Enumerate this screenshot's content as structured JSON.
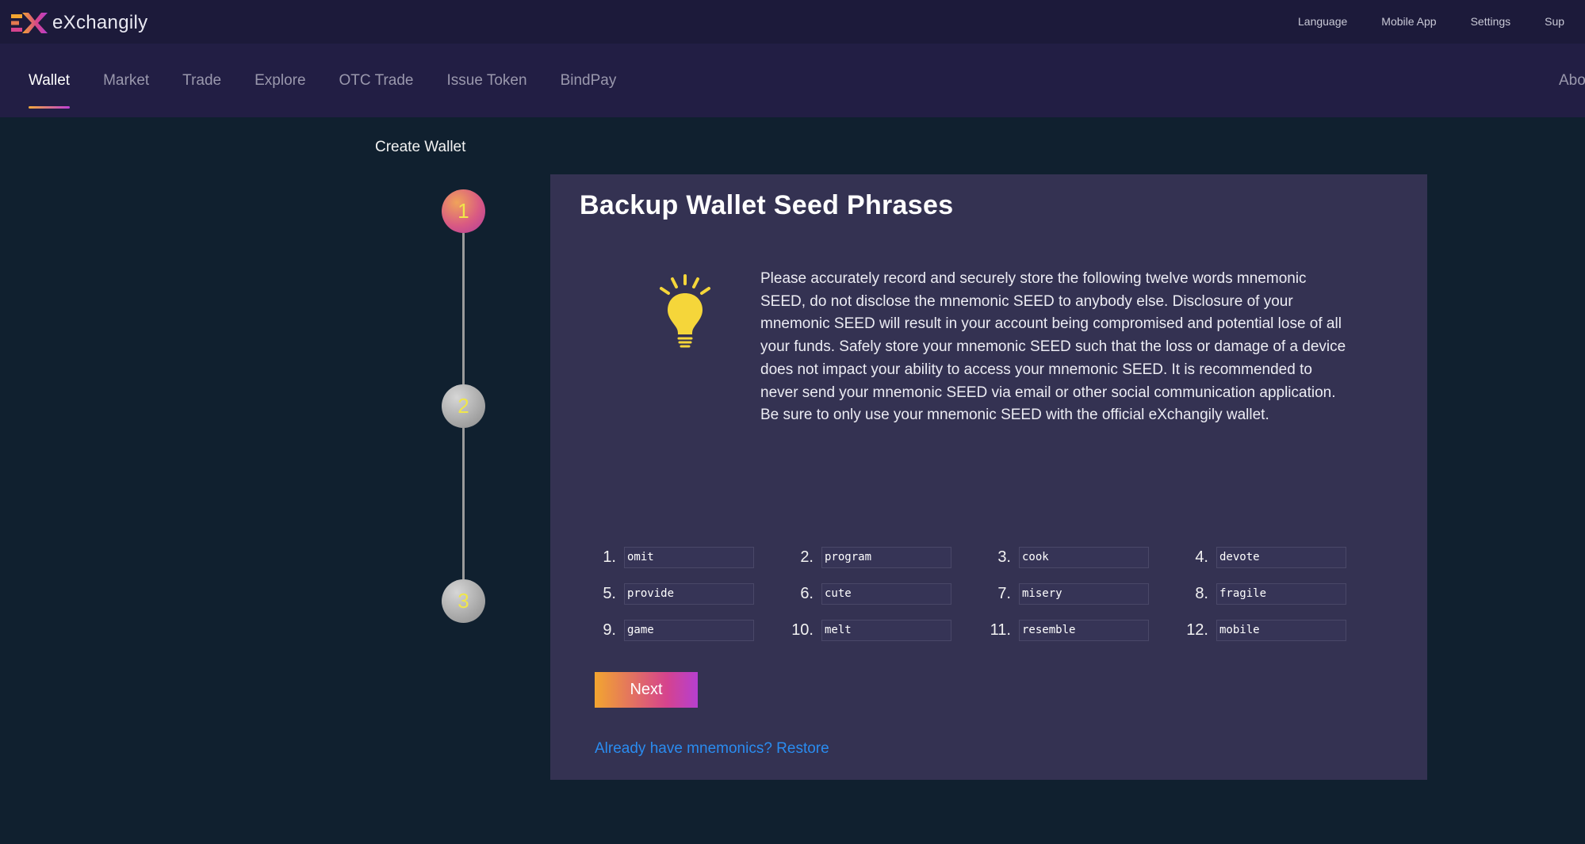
{
  "brand": {
    "name": "eXchangily"
  },
  "top_links": [
    "Language",
    "Mobile App",
    "Settings",
    "Sup"
  ],
  "nav": {
    "tabs": [
      "Wallet",
      "Market",
      "Trade",
      "Explore",
      "OTC Trade",
      "Issue Token",
      "BindPay"
    ],
    "active_index": 0,
    "right_label": "Abo"
  },
  "page_title": "Create Wallet",
  "steps": [
    {
      "label": "1",
      "state": "active"
    },
    {
      "label": "2",
      "state": "inactive"
    },
    {
      "label": "3",
      "state": "inactive"
    }
  ],
  "card": {
    "title": "Backup Wallet Seed Phrases",
    "description": "Please accurately record and securely store the following twelve words mnemonic SEED, do not disclose the mnemonic SEED to anybody else. Disclosure of your mnemonic SEED will result in your account being compromised and potential lose of all your funds. Safely store your mnemonic SEED such that the loss or damage of a device does not impact your ability to access your mnemonic SEED. It is recommended to never send your mnemonic SEED via email or other social communication application. Be sure to only use your mnemonic SEED with the official eXchangily wallet.",
    "icon": "lightbulb-icon",
    "seed_words": [
      {
        "num": "1.",
        "word": "omit"
      },
      {
        "num": "2.",
        "word": "program"
      },
      {
        "num": "3.",
        "word": "cook"
      },
      {
        "num": "4.",
        "word": "devote"
      },
      {
        "num": "5.",
        "word": "provide"
      },
      {
        "num": "6.",
        "word": "cute"
      },
      {
        "num": "7.",
        "word": "misery"
      },
      {
        "num": "8.",
        "word": "fragile"
      },
      {
        "num": "9.",
        "word": "game"
      },
      {
        "num": "10.",
        "word": "melt"
      },
      {
        "num": "11.",
        "word": "resemble"
      },
      {
        "num": "12.",
        "word": "mobile"
      }
    ],
    "next_label": "Next",
    "restore_link": "Already have mnemonics? Restore"
  },
  "colors": {
    "background": "#10202f",
    "topbar": "#1c1a3a",
    "navbar": "#221e44",
    "card": "#343252",
    "accent_start": "#f2a530",
    "accent_end": "#b63fd0",
    "link": "#2a8cf0",
    "bulb": "#f5d63a"
  }
}
